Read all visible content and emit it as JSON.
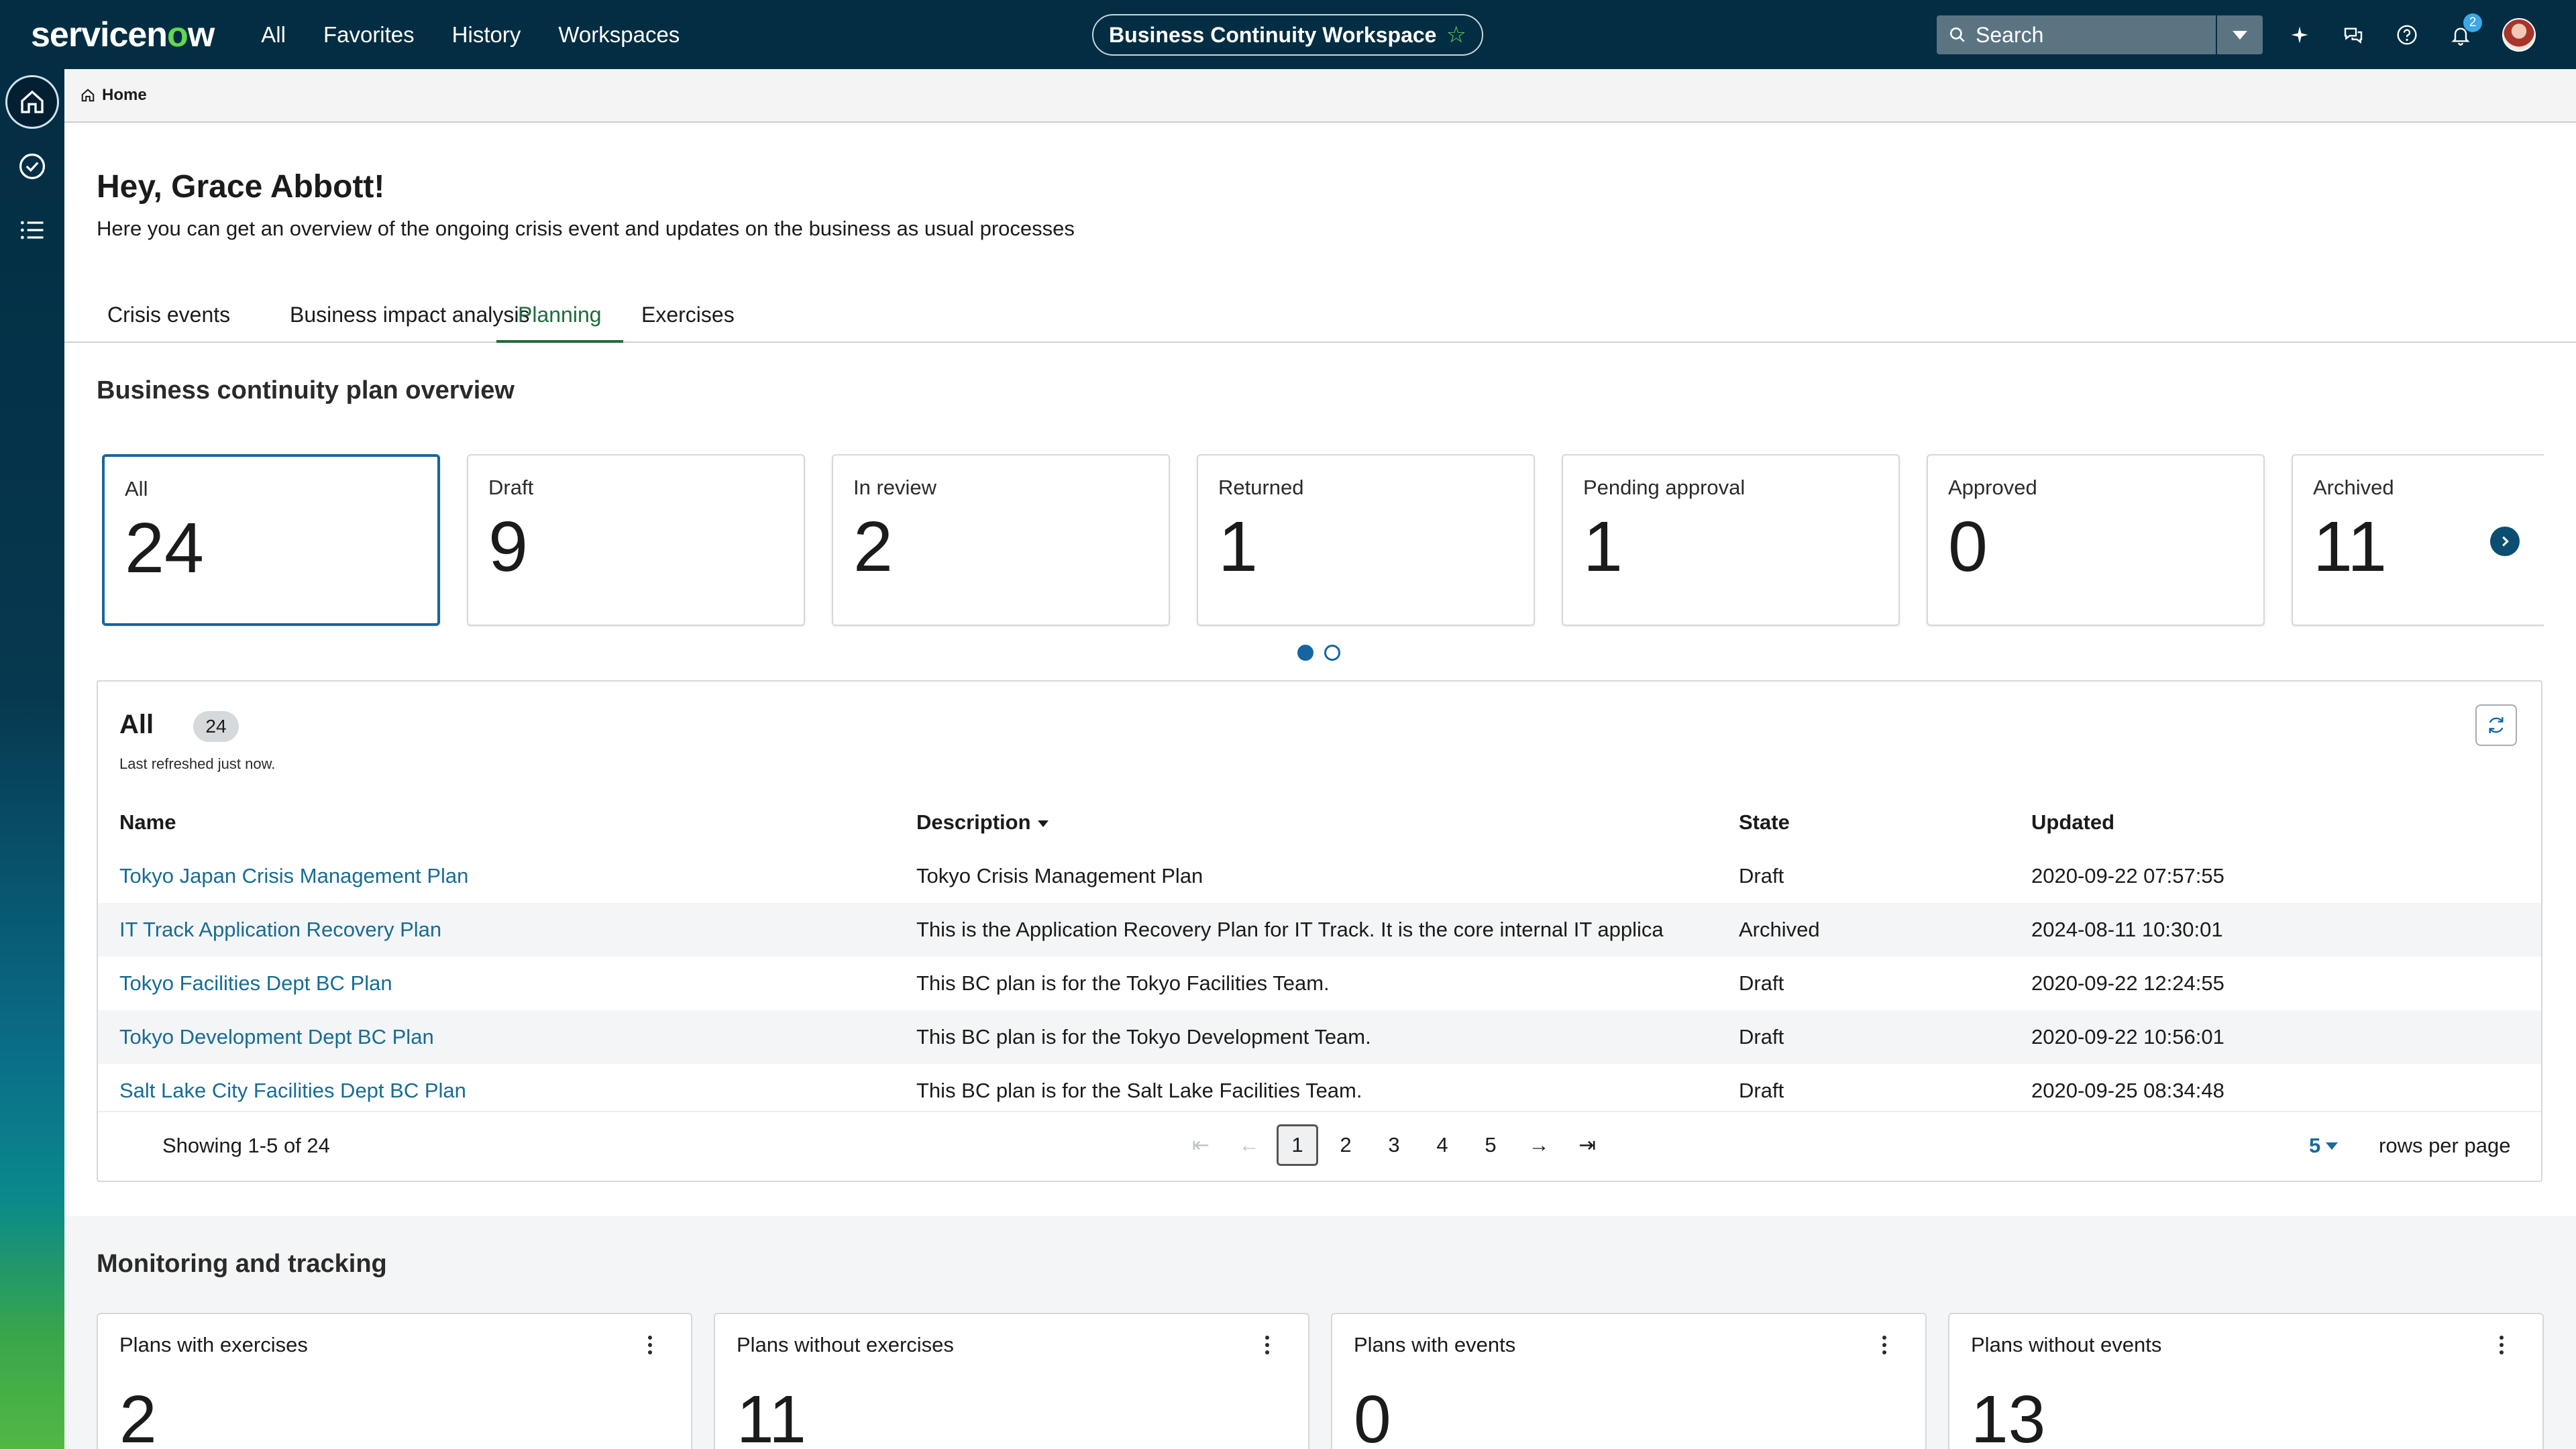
{
  "topbar": {
    "logo_main": "servicen",
    "logo_accent": "o",
    "logo_tail": "w",
    "nav": [
      "All",
      "Favorites",
      "History",
      "Workspaces"
    ],
    "workspace_title": "Business Continuity Workspace",
    "search_placeholder": "Search",
    "notification_count": "2",
    "icons": [
      "sparkle-icon",
      "chat-icon",
      "help-icon",
      "bell-icon"
    ]
  },
  "rail": {
    "items": [
      "home-icon",
      "check-circle-icon",
      "list-icon"
    ]
  },
  "breadcrumb": {
    "home_label": "Home"
  },
  "greeting": {
    "title": "Hey, Grace Abbott!",
    "subtitle": "Here you can get an overview of the ongoing crisis event and updates on the business as usual processes"
  },
  "tabs": [
    {
      "label": "Crisis events"
    },
    {
      "label": "Business impact analysis"
    },
    {
      "label": "Planning"
    },
    {
      "label": "Exercises"
    }
  ],
  "overview": {
    "title": "Business continuity plan overview",
    "cards": [
      {
        "label": "All",
        "value": "24"
      },
      {
        "label": "Draft",
        "value": "9"
      },
      {
        "label": "In review",
        "value": "2"
      },
      {
        "label": "Returned",
        "value": "1"
      },
      {
        "label": "Pending approval",
        "value": "1"
      },
      {
        "label": "Approved",
        "value": "0"
      },
      {
        "label": "Archived",
        "value": "11"
      }
    ]
  },
  "list": {
    "title": "All",
    "count": "24",
    "refreshed": "Last refreshed just now.",
    "columns": [
      "Name",
      "Description",
      "State",
      "Updated"
    ],
    "rows": [
      {
        "name": "Tokyo Japan Crisis Management Plan",
        "description": "Tokyo Crisis Management Plan",
        "state": "Draft",
        "updated": "2020-09-22 07:57:55"
      },
      {
        "name": "IT Track Application Recovery Plan",
        "description": "This is the Application Recovery Plan for IT Track.  It is the core internal IT applica",
        "state": "Archived",
        "updated": "2024-08-11 10:30:01"
      },
      {
        "name": "Tokyo Facilities Dept BC Plan",
        "description": "This BC plan is for the Tokyo Facilities Team.",
        "state": "Draft",
        "updated": "2020-09-22 12:24:55"
      },
      {
        "name": "Tokyo Development Dept BC Plan",
        "description": "This BC plan is for the Tokyo Development Team.",
        "state": "Draft",
        "updated": "2020-09-22 10:56:01"
      },
      {
        "name": "Salt Lake City Facilities Dept BC Plan",
        "description": "This BC plan is for the Salt Lake Facilities Team.",
        "state": "Draft",
        "updated": "2020-09-25 08:34:48"
      }
    ],
    "showing": "Showing 1-5 of 24",
    "pages": [
      "1",
      "2",
      "3",
      "4",
      "5"
    ],
    "rows_per_page_value": "5",
    "rows_per_page_label": "rows per page"
  },
  "monitoring": {
    "title": "Monitoring and tracking",
    "cards": [
      {
        "label": "Plans with exercises",
        "value": "2"
      },
      {
        "label": "Plans without exercises",
        "value": "11"
      },
      {
        "label": "Plans with events",
        "value": "0"
      },
      {
        "label": "Plans without events",
        "value": "13"
      }
    ]
  }
}
